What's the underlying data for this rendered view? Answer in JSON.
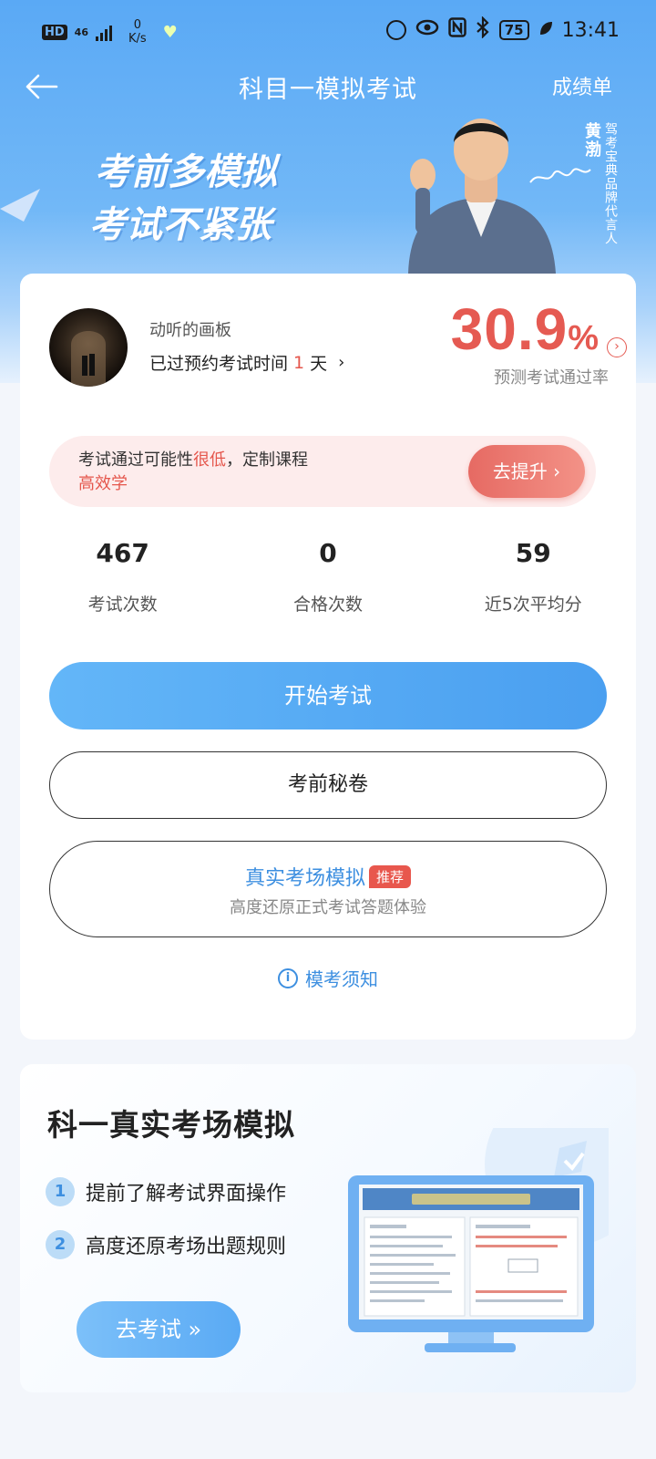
{
  "status_bar": {
    "hd": "HD",
    "network": "46",
    "speed_value": "0",
    "speed_unit": "K/s",
    "battery": "75",
    "time": "13:41"
  },
  "nav": {
    "title": "科目一模拟考试",
    "right_link": "成绩单"
  },
  "banner": {
    "line1": "考前多模拟",
    "line2": "考试不紧张",
    "endorser_name": "黄渤",
    "endorser_title": "驾考宝典品牌代言人"
  },
  "profile": {
    "name": "动听的画板",
    "time_prefix": "已过预约考试时间",
    "days": "1",
    "time_suffix": "天",
    "pass_rate": "30.9",
    "pass_rate_unit": "%",
    "pass_rate_label": "预测考试通过率"
  },
  "tip": {
    "prefix": "考试通过可能性",
    "highlight1": "很低",
    "middle": "，定制课程",
    "highlight2": "高效学",
    "button": "去提升"
  },
  "stats": [
    {
      "value": "467",
      "label": "考试次数"
    },
    {
      "value": "0",
      "label": "合格次数"
    },
    {
      "value": "59",
      "label": "近5次平均分"
    }
  ],
  "buttons": {
    "start": "开始考试",
    "secret": "考前秘卷",
    "real_title": "真实考场模拟",
    "real_badge": "推荐",
    "real_sub": "高度还原正式考试答题体验",
    "notice": "模考须知"
  },
  "promo": {
    "title": "科一真实考场模拟",
    "features": [
      {
        "num": "1",
        "text": "提前了解考试界面操作"
      },
      {
        "num": "2",
        "text": "高度还原考场出题规则"
      }
    ],
    "button": "去考试"
  },
  "colors": {
    "primary_blue": "#4a9ff0",
    "accent_red": "#e55a52"
  }
}
